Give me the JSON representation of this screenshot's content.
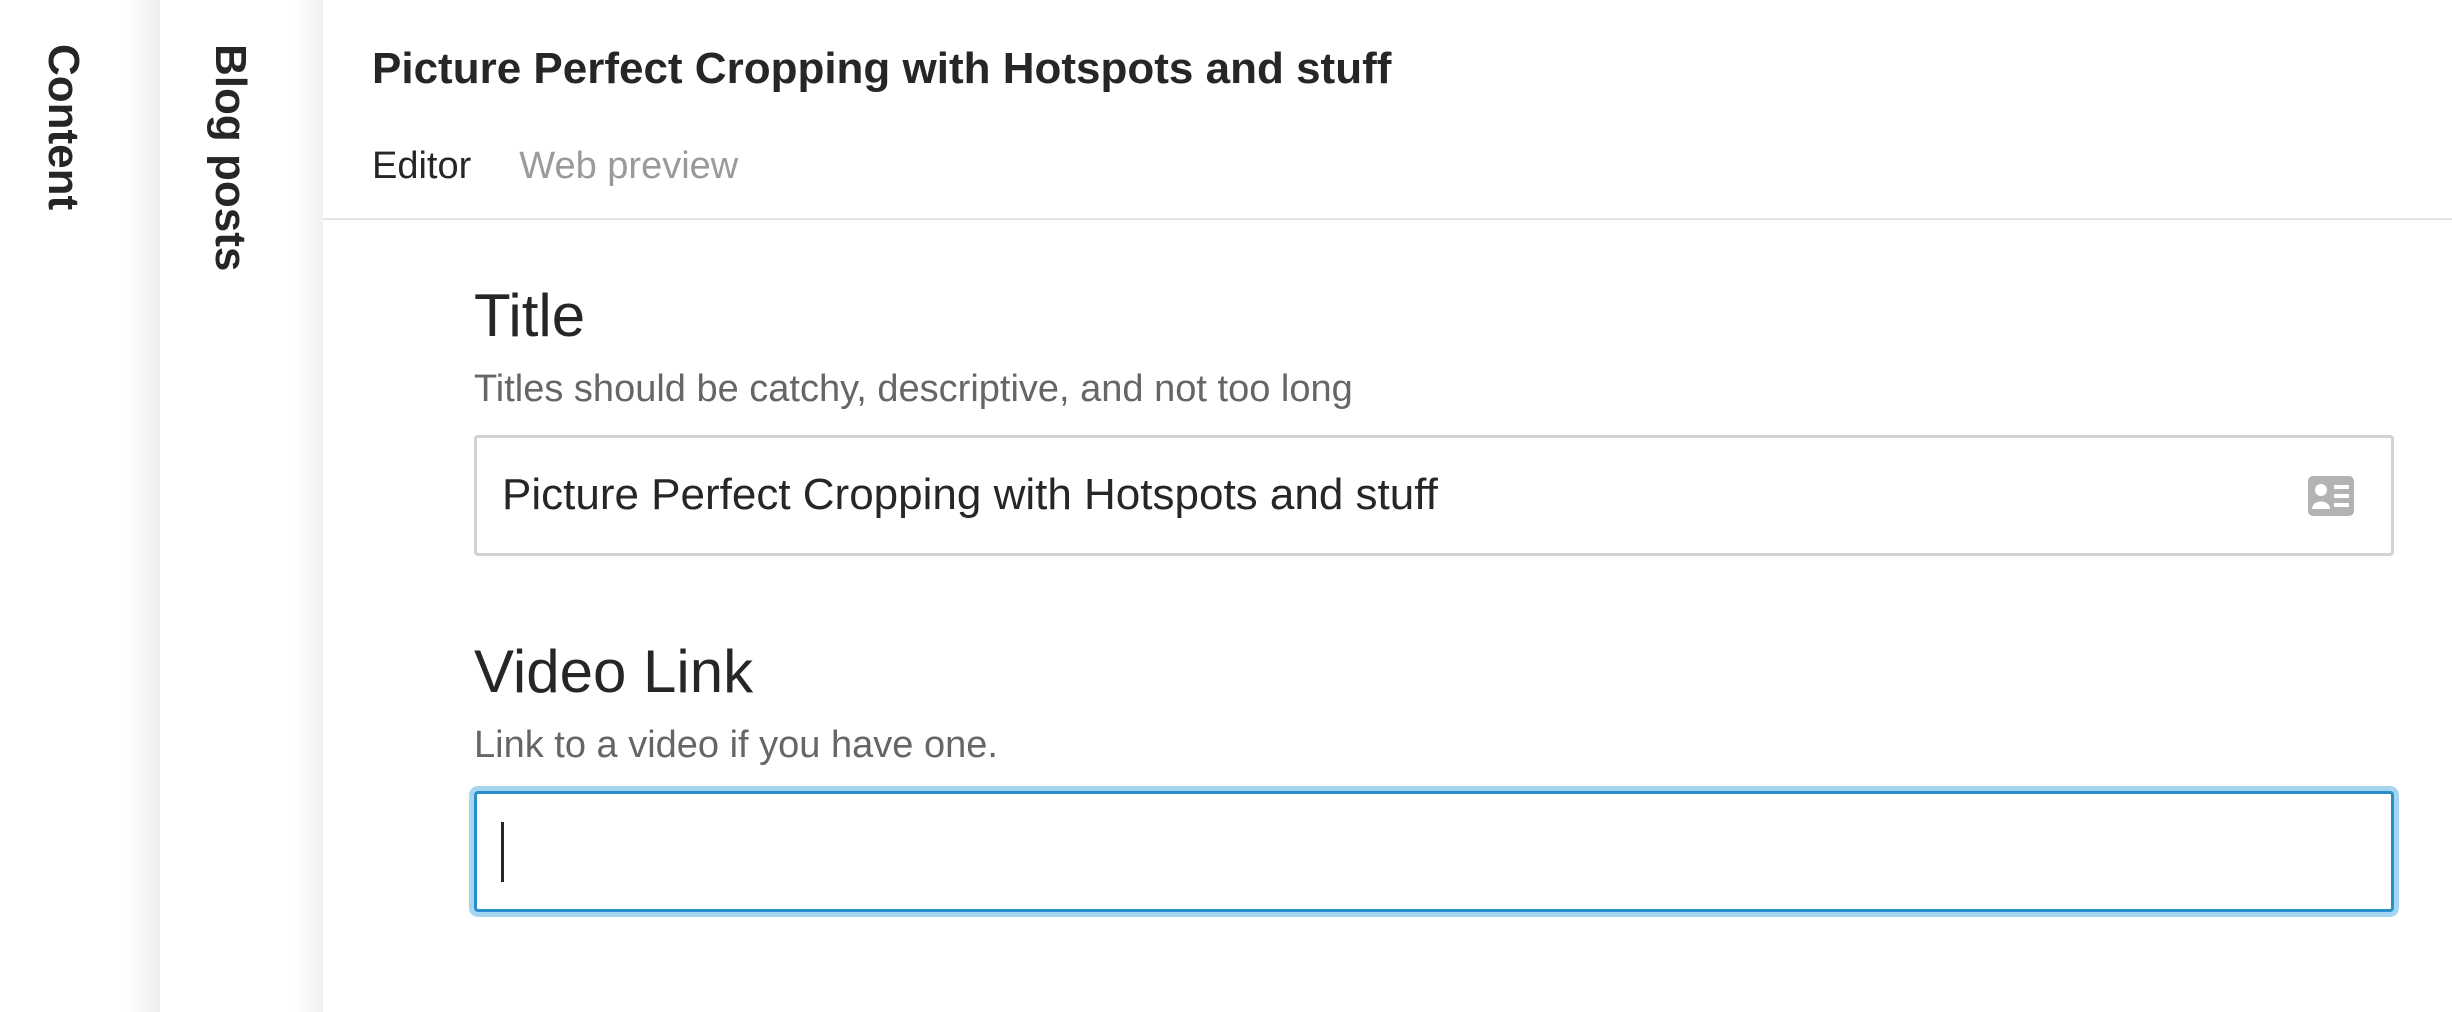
{
  "panes": {
    "content": {
      "label": "Content"
    },
    "blog_posts": {
      "label": "Blog posts"
    }
  },
  "document": {
    "title": "Picture Perfect Cropping with Hotspots and stuff",
    "tabs": [
      {
        "label": "Editor",
        "active": true
      },
      {
        "label": "Web preview",
        "active": false
      }
    ]
  },
  "form": {
    "title_field": {
      "label": "Title",
      "description": "Titles should be catchy, descriptive, and not too long",
      "value": "Picture Perfect Cropping with Hotspots and stuff",
      "icon": "id-card-icon"
    },
    "video_field": {
      "label": "Video Link",
      "description": "Link to a video if you have one.",
      "value": ""
    }
  },
  "colors": {
    "text": "#262626",
    "muted": "#9a9a9a",
    "description": "#666666",
    "border": "#d2d2d2",
    "focus": "#2a8fc9",
    "focus_glow": "#5ab4e6"
  }
}
